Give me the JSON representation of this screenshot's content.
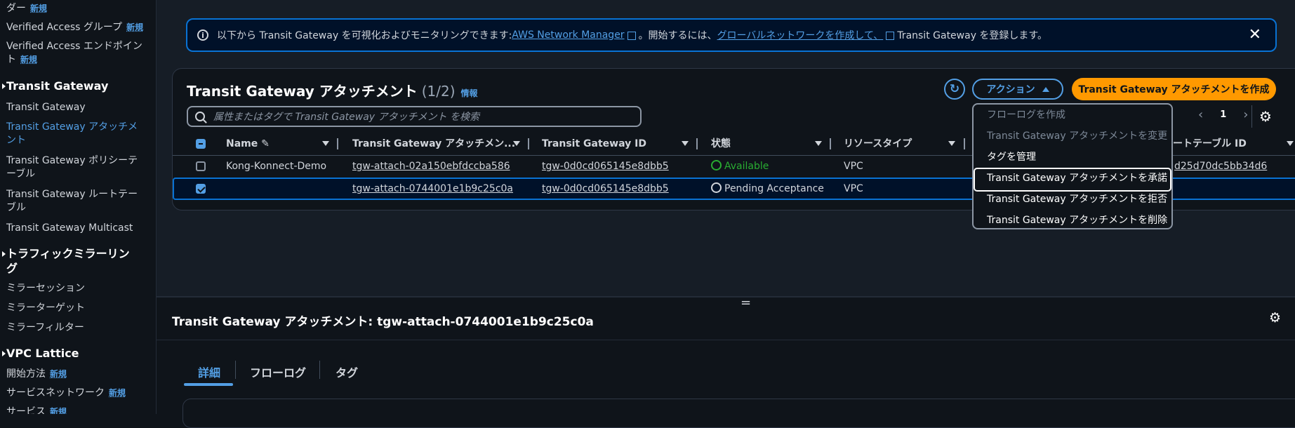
{
  "sidebar": {
    "items": [
      {
        "label": "ダー",
        "new": "新規"
      },
      {
        "label": "Verified Access グループ",
        "new": "新規"
      },
      {
        "label": "Verified Access エンドポイン"
      },
      {
        "label": "ト",
        "new": "新規"
      },
      {
        "label": "Transit Gateway",
        "type": "section"
      },
      {
        "label": "Transit Gateway"
      },
      {
        "label": "Transit Gateway アタッチメ",
        "active": true
      },
      {
        "label": "ント",
        "active": true
      },
      {
        "label": "Transit Gateway ポリシーテ"
      },
      {
        "label": "ーブル"
      },
      {
        "label": "Transit Gateway ルートテー"
      },
      {
        "label": "ブル"
      },
      {
        "label": "Transit Gateway Multicast"
      },
      {
        "label": "トラフィックミラーリン",
        "type": "section"
      },
      {
        "label": "グ",
        "type": "section"
      },
      {
        "label": "ミラーセッション"
      },
      {
        "label": "ミラーターゲット"
      },
      {
        "label": "ミラーフィルター"
      },
      {
        "label": "VPC Lattice",
        "type": "section"
      },
      {
        "label": "開始方法",
        "new": "新規"
      },
      {
        "label": "サービスネットワーク",
        "new": "新規"
      },
      {
        "label": "サービス",
        "new": "新規"
      }
    ]
  },
  "banner": {
    "text1": "以下から Transit Gateway を可視化およびモニタリングできます: ",
    "link1": "AWS Network Manager",
    "text2": "。開始するには、",
    "link2": "グローバルネットワークを作成して、",
    "text3": "Transit Gateway を登録します。",
    "close": "✕"
  },
  "panel": {
    "title": "Transit Gateway アタッチメント",
    "count": "(1/2)",
    "info": "情報",
    "refresh": "↻",
    "actions_label": "アクション",
    "create_label": "Transit Gateway アタッチメントを作成",
    "search_placeholder": "属性またはタグで Transit Gateway アタッチメント を検索",
    "page": "1",
    "prev": "‹",
    "next": "›",
    "settings": "⚙"
  },
  "table": {
    "headers": [
      "Name",
      "Transit Gateway アタッチメン...",
      "Transit Gateway ID",
      "状態",
      "リソースタイプ",
      "ートテーブル ID"
    ],
    "rows": [
      {
        "name": "Kong-Konnect-Demo",
        "attachment": "tgw-attach-02a150ebfdccba586",
        "tgw": "tgw-0d0cd065145e8dbb5",
        "status": "Available",
        "resource": "VPC",
        "route_table": "d25d70dc5bb34d6",
        "selected": false
      },
      {
        "name": "",
        "attachment": "tgw-attach-0744001e1b9c25c0a",
        "tgw": "tgw-0d0cd065145e8dbb5",
        "status": "Pending Acceptance",
        "resource": "VPC",
        "route_table": "",
        "selected": true
      }
    ]
  },
  "menu": {
    "items": [
      {
        "label": "フローログを作成",
        "disabled": true
      },
      {
        "label": "Transit Gateway アタッチメントを変更",
        "disabled": true
      },
      {
        "label": "タグを管理",
        "disabled": false
      },
      {
        "label": "Transit Gateway アタッチメントを承諾",
        "disabled": false,
        "focused": true
      },
      {
        "label": "Transit Gateway アタッチメントを拒否",
        "disabled": false
      },
      {
        "label": "Transit Gateway アタッチメントを削除",
        "disabled": false
      }
    ]
  },
  "details": {
    "title": "Transit Gateway アタッチメント: tgw-attach-0744001e1b9c25c0a",
    "handle": "=",
    "settings": "⚙",
    "tabs": [
      "詳細",
      "フローログ",
      "タグ"
    ]
  },
  "colors": {
    "accent": "#539fe5",
    "primary": "#ff9900",
    "success": "#29ad32",
    "background": "#0f141a"
  }
}
